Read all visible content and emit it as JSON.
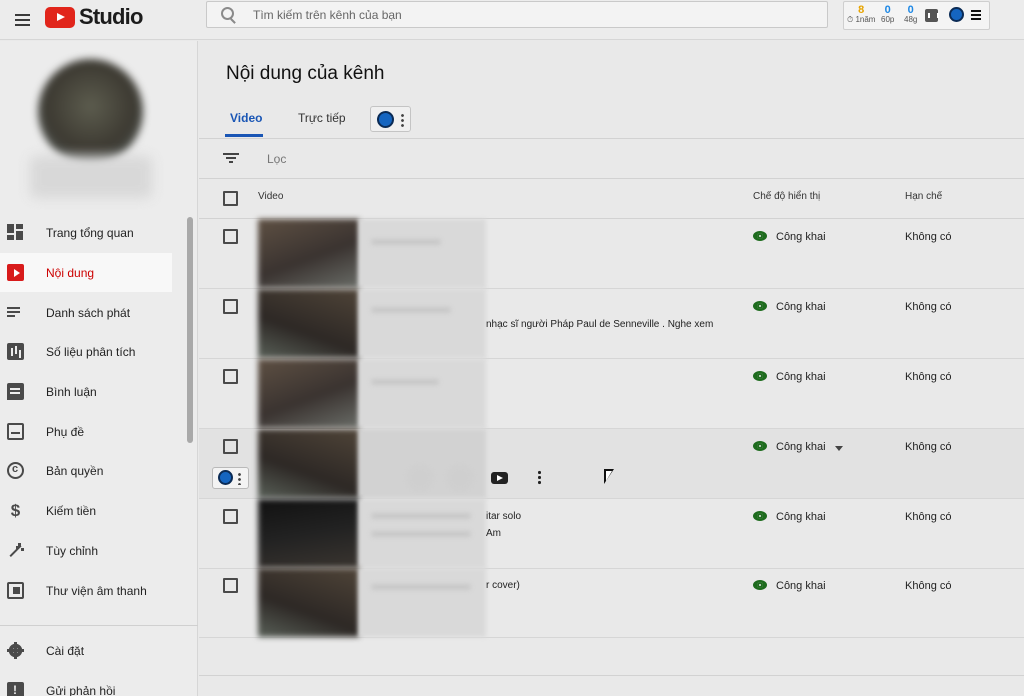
{
  "header": {
    "logo_text": "Studio",
    "search_placeholder": "Tìm kiếm trên kênh của bạn",
    "ext_stats": [
      {
        "value": "8",
        "label": "⏱ 1năm"
      },
      {
        "value": "0",
        "label": "60p"
      },
      {
        "value": "0",
        "label": "48g"
      }
    ]
  },
  "sidebar": {
    "items": [
      {
        "label": "Trang tổng quan",
        "icon": "dashboard-icon"
      },
      {
        "label": "Nội dung",
        "icon": "content-icon",
        "active": true
      },
      {
        "label": "Danh sách phát",
        "icon": "playlist-icon"
      },
      {
        "label": "Số liệu phân tích",
        "icon": "analytics-icon"
      },
      {
        "label": "Bình luận",
        "icon": "comments-icon"
      },
      {
        "label": "Phụ đề",
        "icon": "subtitles-icon"
      },
      {
        "label": "Bản quyền",
        "icon": "copyright-icon"
      },
      {
        "label": "Kiếm tiền",
        "icon": "dollar-icon"
      },
      {
        "label": "Tùy chỉnh",
        "icon": "magic-wand-icon"
      },
      {
        "label": "Thư viện âm thanh",
        "icon": "audio-library-icon"
      }
    ],
    "bottom_items": [
      {
        "label": "Cài đặt",
        "icon": "settings-icon"
      },
      {
        "label": "Gửi phản hồi",
        "icon": "feedback-icon"
      }
    ]
  },
  "main": {
    "title": "Nội dung của kênh",
    "tabs": [
      {
        "label": "Video",
        "active": true
      },
      {
        "label": "Trực tiếp"
      }
    ],
    "filter_label": "Lọc",
    "columns": {
      "video": "Video",
      "visibility": "Chế độ hiển thị",
      "restrictions": "Hạn chế"
    },
    "rows": [
      {
        "title_line1": "",
        "title_line2": "",
        "visibility": "Công khai",
        "restrictions": "Không có"
      },
      {
        "title_line1": "",
        "title_line2": "nhạc sĩ người Pháp Paul de Senneville . Nghe xem",
        "visibility": "Công khai",
        "restrictions": "Không có"
      },
      {
        "title_line1": "",
        "title_line2": "",
        "visibility": "Công khai",
        "restrictions": "Không có"
      },
      {
        "title_line1": "",
        "title_line2": "",
        "visibility": "Công khai",
        "restrictions": "Không có",
        "hover": true
      },
      {
        "title_line1": "itar solo",
        "title_line2": "Am",
        "visibility": "Công khai",
        "restrictions": "Không có"
      },
      {
        "title_line1": "r cover)",
        "title_line2": "",
        "visibility": "Công khai",
        "restrictions": "Không có"
      }
    ]
  },
  "colors": {
    "accent": "#1a56b5",
    "active_nav": "#cc0000",
    "public_icon": "#1d6b1d",
    "brand_red": "#e1251b"
  }
}
